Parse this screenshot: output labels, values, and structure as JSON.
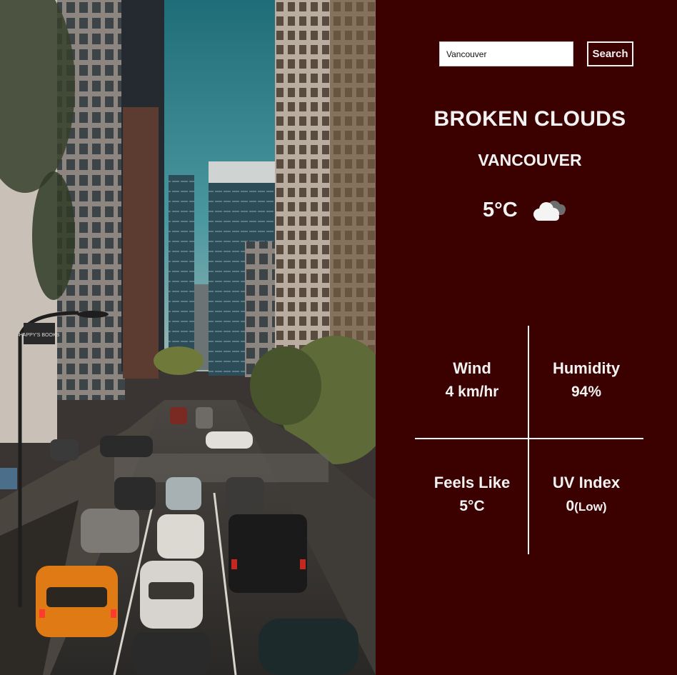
{
  "search": {
    "value": "Vancouver",
    "button_label": "Search"
  },
  "weather": {
    "description": "BROKEN CLOUDS",
    "city": "VANCOUVER",
    "temperature": "5°C",
    "condition_icon": "broken-clouds-icon"
  },
  "details": {
    "wind": {
      "label": "Wind",
      "value": "4 km/hr"
    },
    "humidity": {
      "label": "Humidity",
      "value": "94%"
    },
    "feels_like": {
      "label": "Feels Like",
      "value": "5°C"
    },
    "uv_index": {
      "label": "UV Index",
      "value": "0",
      "level": "(Low)"
    }
  },
  "sign_text": "HAPPY'S BOOKS",
  "colors": {
    "panel_bg": "#3b0000",
    "text": "#f2f2f2",
    "sky": "#2f7f85",
    "taxi": "#e07a14"
  }
}
